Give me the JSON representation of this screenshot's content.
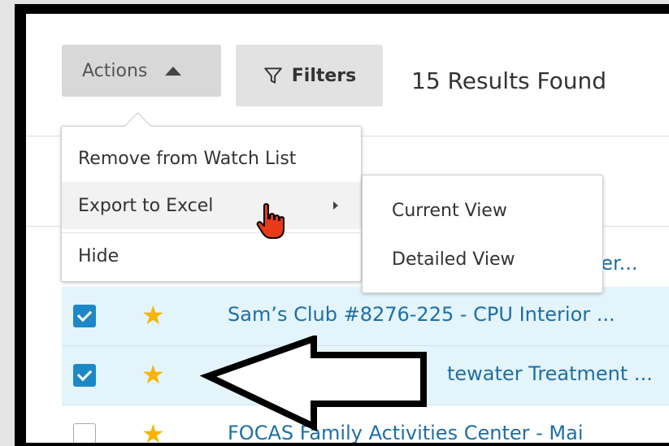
{
  "toolbar": {
    "actions_label": "Actions",
    "filters_label": "Filters",
    "results_text": "15 Results Found"
  },
  "actions_menu": {
    "items": [
      {
        "label": "Remove from Watch List"
      },
      {
        "label": "Export to Excel"
      },
      {
        "label": "Hide"
      }
    ]
  },
  "export_submenu": {
    "items": [
      {
        "label": "Current View"
      },
      {
        "label": "Detailed View"
      }
    ]
  },
  "rows": [
    {
      "text": "per...",
      "checked": false,
      "starred": false
    },
    {
      "text": "Sam’s Club #8276-225 - CPU Interior ...",
      "checked": true,
      "starred": true
    },
    {
      "text": "tewater Treatment ...",
      "checked": true,
      "starred": true
    },
    {
      "text": "FOCAS Family Activities Center - Mai",
      "checked": false,
      "starred": true
    }
  ],
  "colors": {
    "accent": "#1e88c7",
    "link": "#1d6fa5",
    "star": "#f7b500",
    "selected_row": "#e3f4fb",
    "cursor": "#e8391a"
  },
  "icons": {
    "caret": "caret-up-icon",
    "filter": "funnel-icon",
    "submenu": "chevron-right-icon",
    "star": "star-icon",
    "cursor": "hand-pointer-icon",
    "annotation": "left-arrow-annotation"
  }
}
